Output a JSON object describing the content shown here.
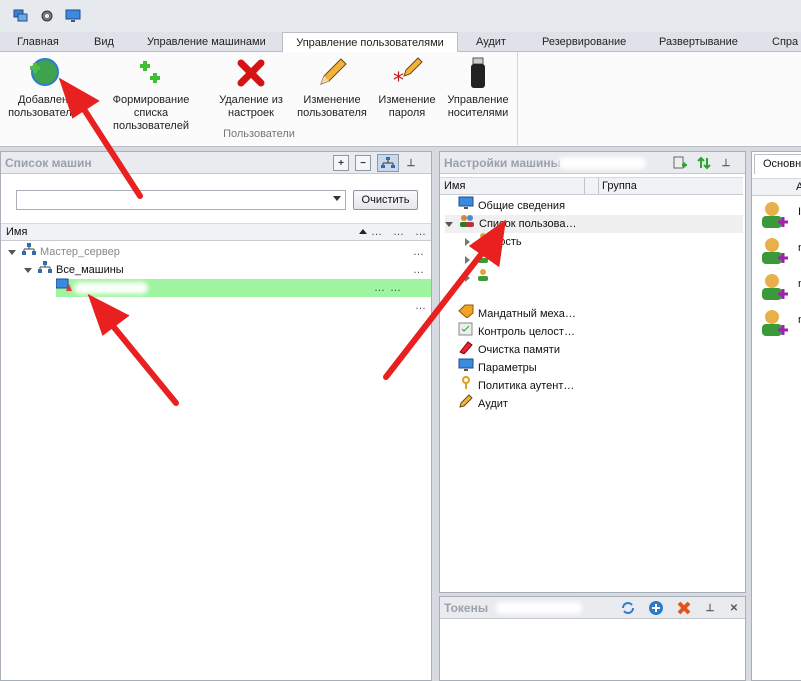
{
  "quick_access": [
    "windows-icon",
    "gear-icon",
    "monitor-icon"
  ],
  "tabs": [
    "Главная",
    "Вид",
    "Управление машинами",
    "Управление пользователями",
    "Аудит",
    "Резервирование",
    "Развертывание",
    "Спра"
  ],
  "ribbon": {
    "buttons": [
      {
        "line1": "Добавлен",
        "line2": "пользователе",
        "icon": "add-user-globe-icon"
      },
      {
        "line1": "Формирование списка",
        "line2": "пользователей",
        "icon": "plus-plus-icon"
      },
      {
        "line1": "Удаление из",
        "line2": "настроек",
        "icon": "red-x-icon"
      },
      {
        "line1": "Изменение",
        "line2": "пользователя",
        "icon": "pencil-icon"
      },
      {
        "line1": "Изменение",
        "line2": "пароля",
        "icon": "pencil-asterisk-icon"
      },
      {
        "line1": "Управление",
        "line2": "носителями",
        "icon": "usb-drive-icon"
      }
    ],
    "group_label": "Пользователи"
  },
  "machines_panel": {
    "title": "Список машин",
    "clear_label": "Очистить",
    "col_name": "Имя",
    "col_dots": "…",
    "rows": [
      {
        "label": "Мастер_сервер",
        "dots": "…"
      },
      {
        "label": "Все_машины",
        "dots": "…"
      },
      {
        "label": "",
        "dots": "… …"
      },
      {
        "label": "",
        "dots": "…"
      }
    ]
  },
  "settings_panel": {
    "title": "Настройки машины",
    "col_name": "Имя",
    "col_group": "Группа",
    "items": [
      {
        "label": "Общие сведения",
        "icon": "monitor-icon"
      },
      {
        "label": "Список пользова…",
        "icon": "users-icon"
      },
      {
        "label": "Гость",
        "icon": "user-icon"
      },
      {
        "label": "",
        "icon": "user-icon"
      },
      {
        "label": "",
        "icon": "user-icon"
      },
      {
        "label": "Мандатный меха…",
        "icon": "tag-icon"
      },
      {
        "label": "Контроль целост…",
        "icon": "checklist-icon"
      },
      {
        "label": "Очистка памяти",
        "icon": "eraser-icon"
      },
      {
        "label": "Параметры",
        "icon": "monitor-icon"
      },
      {
        "label": "Политика аутент…",
        "icon": "key-icon"
      },
      {
        "label": "Аудит",
        "icon": "pencil-icon"
      }
    ]
  },
  "tokens_panel": {
    "title": "Токены"
  },
  "right_panel": {
    "tab": "Основна",
    "col": "А",
    "rows": [
      "I",
      "n",
      "n",
      "n"
    ]
  },
  "colors": {
    "selection": "#9ff59f",
    "arrow": "#e8201f"
  }
}
